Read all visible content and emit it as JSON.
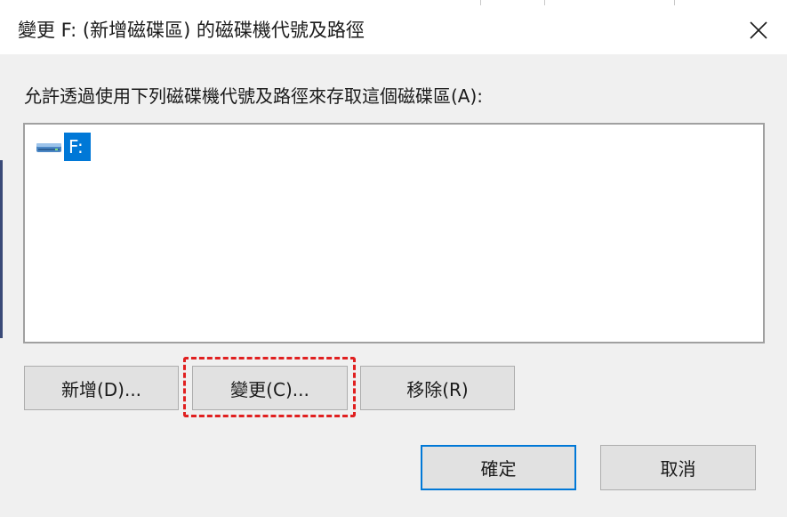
{
  "window": {
    "title": "變更 F: (新增磁碟區) 的磁碟機代號及路徑"
  },
  "prompt": "允許透過使用下列磁碟機代號及路徑來存取這個磁碟區(A):",
  "list": {
    "items": [
      {
        "label": "F:",
        "icon": "drive-icon",
        "selected": true
      }
    ]
  },
  "buttons": {
    "add": "新增(D)...",
    "change": "變更(C)...",
    "remove": "移除(R)",
    "ok": "確定",
    "cancel": "取消"
  },
  "colors": {
    "selection": "#0078d7",
    "highlight": "#e02020",
    "background": "#f0f0f0"
  },
  "icons": {
    "close": "close-icon",
    "drive": "drive-icon"
  }
}
